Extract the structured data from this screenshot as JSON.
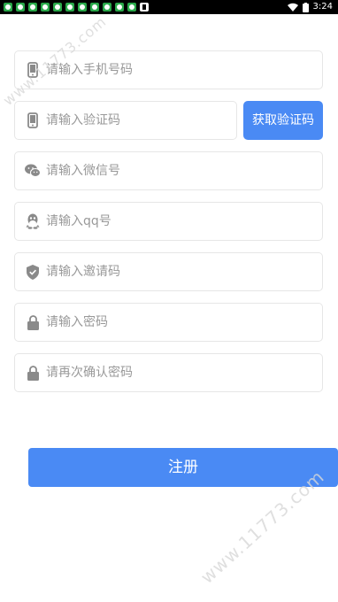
{
  "status_bar": {
    "time": "3:24",
    "notification_icons": [
      "app-icon",
      "app-icon",
      "app-icon",
      "app-icon",
      "app-icon",
      "app-icon",
      "app-icon",
      "app-icon",
      "app-icon",
      "app-icon",
      "app-icon",
      "mail-icon"
    ],
    "wifi_icon": "wifi-icon",
    "battery_icon": "battery-icon"
  },
  "form": {
    "phone": {
      "placeholder": "请输入手机号码",
      "icon": "phone-icon"
    },
    "verify_code": {
      "placeholder": "请输入验证码",
      "icon": "phone-icon"
    },
    "get_code_button": "获取验证码",
    "wechat": {
      "placeholder": "请输入微信号",
      "icon": "wechat-icon"
    },
    "qq": {
      "placeholder": "请输入qq号",
      "icon": "qq-icon"
    },
    "invite_code": {
      "placeholder": "请输入邀请码",
      "icon": "shield-icon"
    },
    "password": {
      "placeholder": "请输入密码",
      "icon": "lock-icon"
    },
    "confirm_password": {
      "placeholder": "请再次确认密码",
      "icon": "lock-icon"
    },
    "register_button": "注册"
  },
  "watermark": {
    "text": "www.11773.com"
  },
  "colors": {
    "accent": "#4a8af4",
    "icon": "#8a8a8a",
    "placeholder": "#999999",
    "border": "#e6e6e6"
  }
}
